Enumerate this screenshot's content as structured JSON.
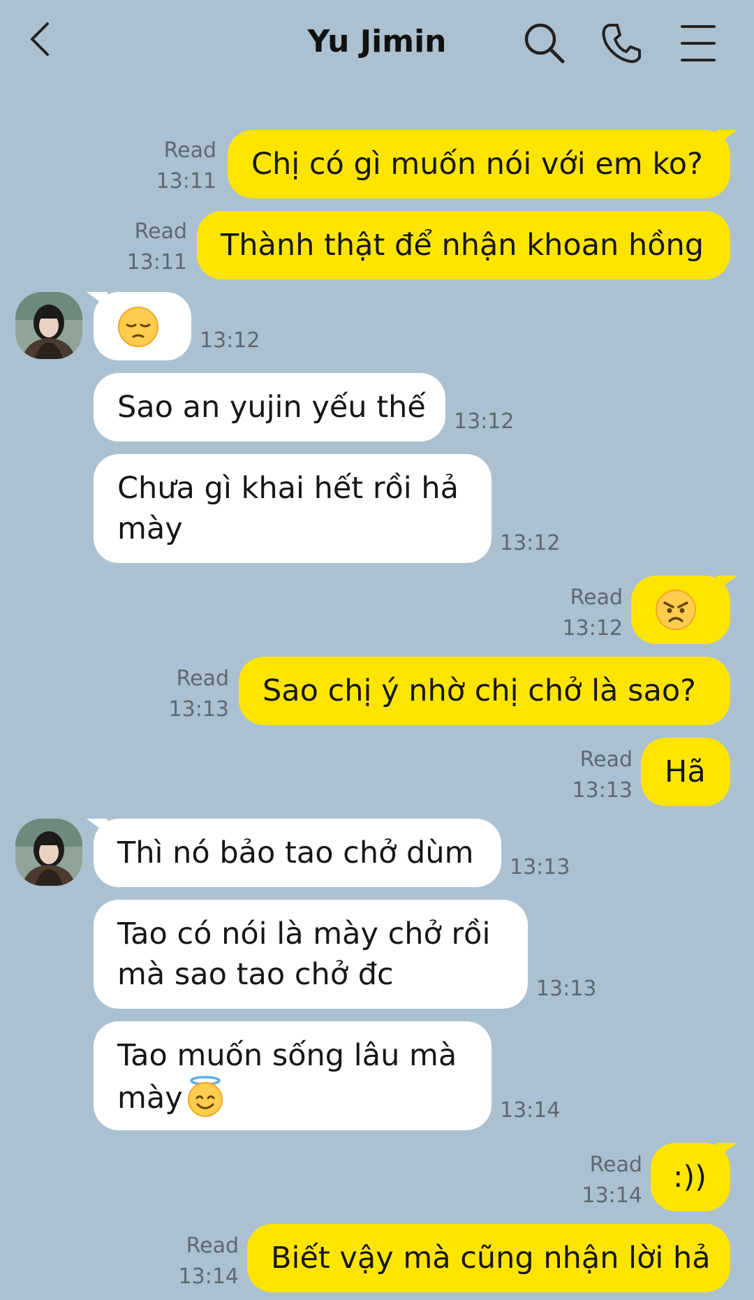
{
  "header": {
    "title": "Yu Jimin",
    "back_icon": "chevron-left-icon",
    "search_icon": "search-icon",
    "call_icon": "phone-icon",
    "menu_icon": "menu-icon"
  },
  "colors": {
    "background": "#abc1d1",
    "my_bubble": "#fee500",
    "their_bubble": "#ffffff"
  },
  "messages": [
    {
      "from": "me",
      "text": "Chị có gì muốn nói với em ko?",
      "read": "Read",
      "time": "13:11"
    },
    {
      "from": "me",
      "text": "Thành thật để nhận khoan hồng",
      "read": "Read",
      "time": "13:11"
    },
    {
      "from": "them",
      "emoji": "pensive-face",
      "time": "13:12"
    },
    {
      "from": "them",
      "text": "Sao an yujin yếu thế",
      "time": "13:12"
    },
    {
      "from": "them",
      "text": "Chưa gì khai hết rồi hả",
      "text2": "mày",
      "time": "13:12"
    },
    {
      "from": "me",
      "emoji": "angry-face",
      "read": "Read",
      "time": "13:12"
    },
    {
      "from": "me",
      "text": "Sao chị ý nhờ chị chở là sao?",
      "read": "Read",
      "time": "13:13"
    },
    {
      "from": "me",
      "text": "Hã",
      "read": "Read",
      "time": "13:13"
    },
    {
      "from": "them",
      "text": "Thì nó bảo tao chở dùm",
      "time": "13:13"
    },
    {
      "from": "them",
      "text": "Tao có nói là mày chở rồi",
      "text2": "mà sao tao chở đc",
      "time": "13:13"
    },
    {
      "from": "them",
      "text": "Tao muốn sống lâu mà",
      "text2": "mày",
      "emoji": "smiling-face-with-halo",
      "time": "13:14"
    },
    {
      "from": "me",
      "text": ":))",
      "read": "Read",
      "time": "13:14"
    },
    {
      "from": "me",
      "text": "Biết vậy mà cũng nhận lời hả",
      "read": "Read",
      "time": "13:14"
    }
  ]
}
